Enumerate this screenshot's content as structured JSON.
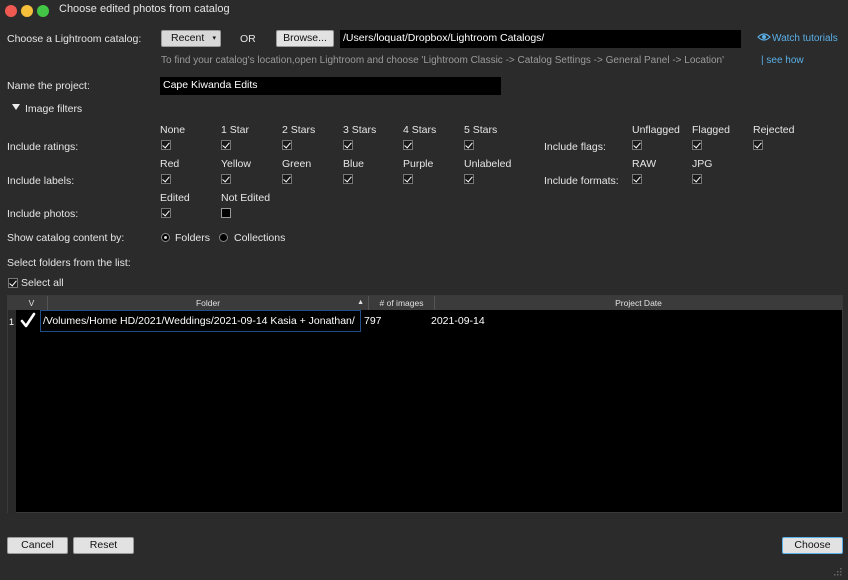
{
  "window": {
    "title": "Choose edited photos from catalog"
  },
  "catalog": {
    "label": "Choose a Lightroom catalog:",
    "recent_label": "Recent",
    "or_label": "OR",
    "browse_label": "Browse...",
    "path": "/Users/loquat/Dropbox/Lightroom Catalogs/",
    "tutorials_label": "Watch tutorials",
    "hint": "To find your catalog's location,open Lightroom and choose 'Lightroom Classic -> Catalog Settings -> General Panel -> Location'",
    "see_how": "| see how"
  },
  "project": {
    "label": "Name the project:",
    "value": "Cape Kiwanda Edits"
  },
  "filters": {
    "toggle_label": "Image filters"
  },
  "ratings": {
    "label": "Include ratings:",
    "options": [
      {
        "label": "None",
        "checked": true
      },
      {
        "label": "1 Star",
        "checked": true
      },
      {
        "label": "2 Stars",
        "checked": true
      },
      {
        "label": "3 Stars",
        "checked": true
      },
      {
        "label": "4 Stars",
        "checked": true
      },
      {
        "label": "5 Stars",
        "checked": true
      }
    ]
  },
  "flags": {
    "label": "Include flags:",
    "options": [
      {
        "label": "Unflagged",
        "checked": true
      },
      {
        "label": "Flagged",
        "checked": true
      },
      {
        "label": "Rejected",
        "checked": true
      }
    ]
  },
  "labels": {
    "label": "Include labels:",
    "options": [
      {
        "label": "Red",
        "checked": true
      },
      {
        "label": "Yellow",
        "checked": true
      },
      {
        "label": "Green",
        "checked": true
      },
      {
        "label": "Blue",
        "checked": true
      },
      {
        "label": "Purple",
        "checked": true
      },
      {
        "label": "Unlabeled",
        "checked": true
      }
    ]
  },
  "formats": {
    "label": "Include formats:",
    "options": [
      {
        "label": "RAW",
        "checked": true
      },
      {
        "label": "JPG",
        "checked": true
      }
    ]
  },
  "photos": {
    "label": "Include photos:",
    "options": [
      {
        "label": "Edited",
        "checked": true
      },
      {
        "label": "Not Edited",
        "checked": false
      }
    ]
  },
  "show_by": {
    "label": "Show catalog content by:",
    "folders_label": "Folders",
    "collections_label": "Collections",
    "selected": "Folders"
  },
  "list": {
    "label": "Select folders from the list:",
    "select_all_label": "Select all",
    "select_all_checked": true
  },
  "table": {
    "headers": {
      "check": "V",
      "folder": "Folder",
      "count": "# of images",
      "date": "Project Date"
    },
    "rows": [
      {
        "num": "1",
        "checked": true,
        "folder": "/Volumes/Home HD/2021/Weddings/2021-09-14 Kasia + Jonathan/",
        "count": "797",
        "date": "2021-09-14"
      }
    ]
  },
  "footer": {
    "cancel_label": "Cancel",
    "reset_label": "Reset",
    "choose_label": "Choose"
  },
  "colors": {
    "accent": "#5ab0e8",
    "background": "#2b2b2b"
  }
}
